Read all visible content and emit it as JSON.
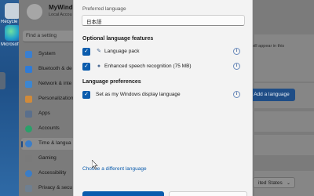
{
  "desktop": {
    "icons": [
      {
        "label": "Recycle Bin",
        "color": "#c9d3dc"
      },
      {
        "label": "Microsoft Edge",
        "color": "#23a3c9"
      }
    ]
  },
  "settings": {
    "profile": {
      "name": "MyWindo",
      "subtitle": "Local Accou"
    },
    "search": {
      "placeholder": "Find a setting"
    },
    "nav": [
      {
        "label": "System",
        "icon": "monitor-icon",
        "color": "#3a7fd0",
        "active": false
      },
      {
        "label": "Bluetooth & de",
        "icon": "bluetooth-icon",
        "color": "#2f7bd6",
        "active": false
      },
      {
        "label": "Network & inte",
        "icon": "wifi-icon",
        "color": "#3c86d1",
        "active": false
      },
      {
        "label": "Personalization",
        "icon": "brush-icon",
        "color": "#d08a3a",
        "active": false
      },
      {
        "label": "Apps",
        "icon": "apps-icon",
        "color": "#5a6f8c",
        "active": false
      },
      {
        "label": "Accounts",
        "icon": "person-icon",
        "color": "#2aa06a",
        "active": false
      },
      {
        "label": "Time & langua",
        "icon": "globe-clock-icon",
        "color": "#3b7dc7",
        "active": true
      },
      {
        "label": "Gaming",
        "icon": "gamepad-icon",
        "color": "#7a7a7a",
        "active": false
      },
      {
        "label": "Accessibility",
        "icon": "accessibility-icon",
        "color": "#3b7dc7",
        "active": false
      },
      {
        "label": "Privacy & secu",
        "icon": "shield-icon",
        "color": "#6f7f90",
        "active": false
      }
    ],
    "right_text": "will appear in this",
    "add_language_label": "Add a language",
    "region_value": "ited States"
  },
  "dialog": {
    "preferred_language_label": "Preferred language",
    "preferred_language_value": "日本語",
    "optional_features_title": "Optional language features",
    "optional_features": [
      {
        "label": "Language pack",
        "checked": true,
        "icon": "language-pack-icon"
      },
      {
        "label": "Enhanced speech recognition (75 MB)",
        "checked": true,
        "icon": "microphone-icon"
      }
    ],
    "language_preferences_title": "Language preferences",
    "language_preferences": [
      {
        "label": "Set as my Windows display language",
        "checked": true
      }
    ],
    "choose_different_link": "Choose a different language",
    "accent_color": "#0b5cad"
  }
}
